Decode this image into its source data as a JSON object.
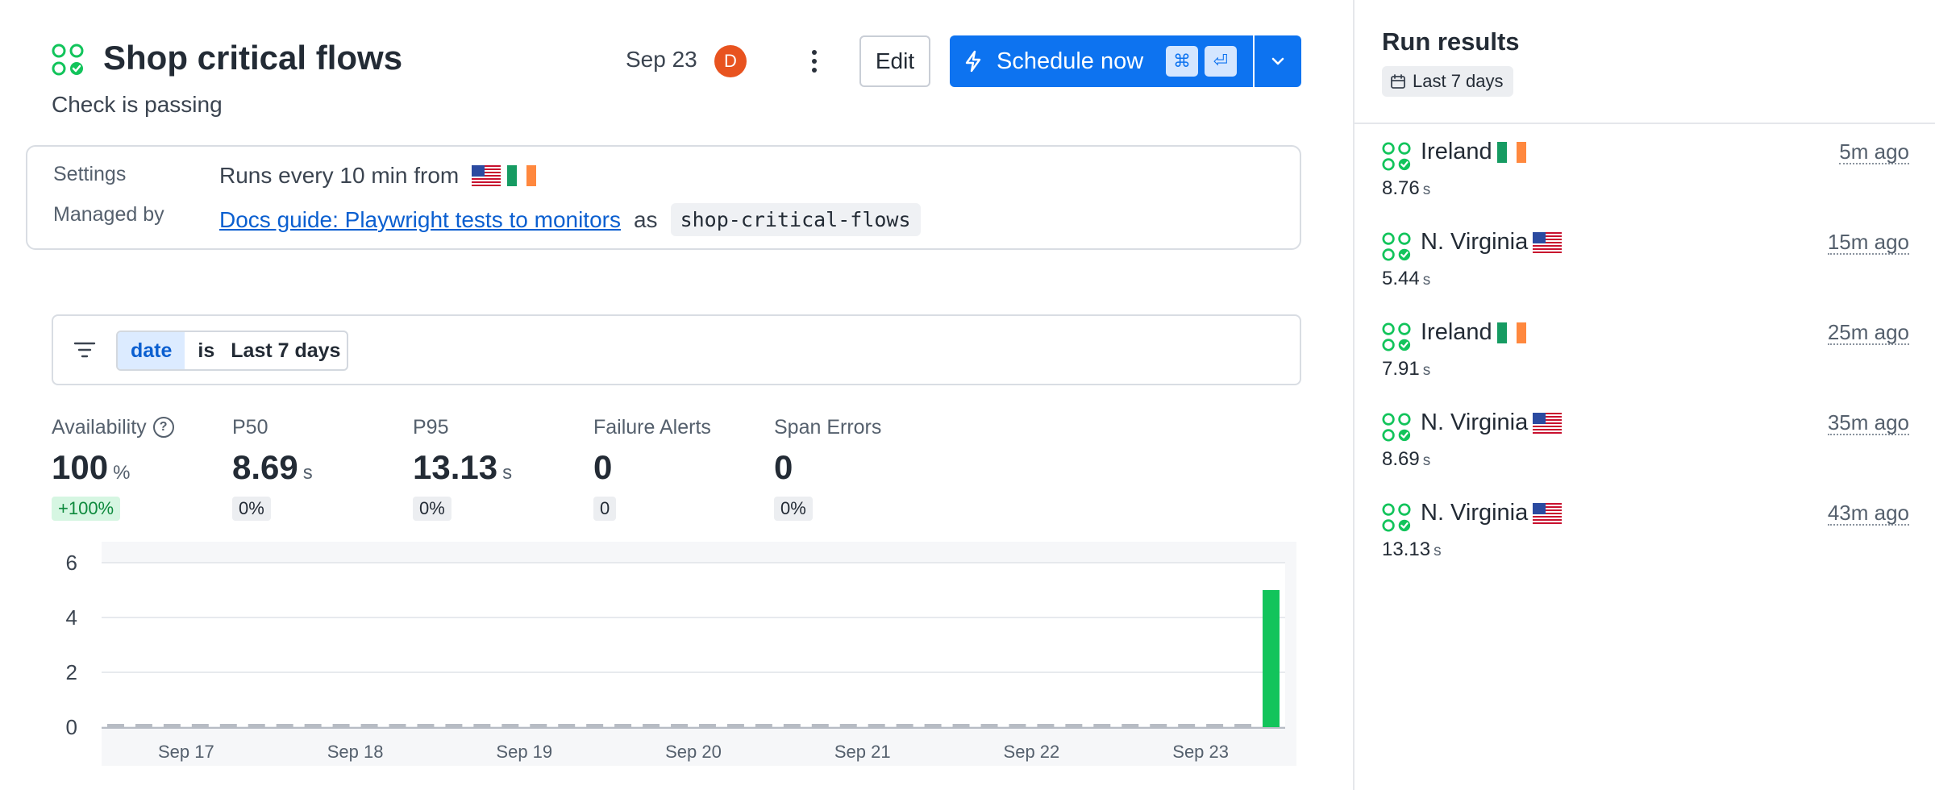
{
  "header": {
    "title": "Shop critical flows",
    "status_text": "Check is passing",
    "date": "Sep 23",
    "avatar_initial": "D",
    "edit_label": "Edit",
    "schedule_label": "Schedule now",
    "kbd_cmd": "⌘",
    "kbd_enter": "⏎"
  },
  "settings": {
    "settings_label": "Settings",
    "settings_value": "Runs every 10 min from",
    "managed_label": "Managed by",
    "managed_link": "Docs guide: Playwright tests to monitors",
    "managed_as": "as",
    "managed_code": "shop-critical-flows"
  },
  "filter": {
    "key": "date",
    "operator": "is",
    "value": "Last 7 days"
  },
  "metrics": [
    {
      "label": "Availability",
      "value": "100",
      "unit": "%",
      "badge": "+100%"
    },
    {
      "label": "P50",
      "value": "8.69",
      "unit": "s",
      "badge": "0%"
    },
    {
      "label": "P95",
      "value": "13.13",
      "unit": "s",
      "badge": "0%"
    },
    {
      "label": "Failure Alerts",
      "value": "0",
      "unit": "",
      "badge": "0"
    },
    {
      "label": "Span Errors",
      "value": "0",
      "unit": "",
      "badge": "0%"
    }
  ],
  "chart_data": {
    "type": "bar",
    "x_ticks": [
      "Sep 17",
      "Sep 18",
      "Sep 19",
      "Sep 20",
      "Sep 21",
      "Sep 22",
      "Sep 23"
    ],
    "y_ticks": [
      0,
      2,
      4,
      6
    ],
    "ylim": [
      0,
      6
    ],
    "bucket_count": 42,
    "values": [
      0,
      0,
      0,
      0,
      0,
      0,
      0,
      0,
      0,
      0,
      0,
      0,
      0,
      0,
      0,
      0,
      0,
      0,
      0,
      0,
      0,
      0,
      0,
      0,
      0,
      0,
      0,
      0,
      0,
      0,
      0,
      0,
      0,
      0,
      0,
      0,
      0,
      0,
      0,
      0,
      0,
      5
    ],
    "series_color": "#12c45b",
    "zero_color": "#b7bcc4",
    "grid": true,
    "xlabel": "",
    "ylabel": "",
    "title": ""
  },
  "sidebar": {
    "title": "Run results",
    "filter_label": "Last 7 days",
    "runs": [
      {
        "location": "Ireland",
        "flag": "ie",
        "time": "5m ago",
        "duration": "8.76",
        "unit": "s"
      },
      {
        "location": "N. Virginia",
        "flag": "us",
        "time": "15m ago",
        "duration": "5.44",
        "unit": "s"
      },
      {
        "location": "Ireland",
        "flag": "ie",
        "time": "25m ago",
        "duration": "7.91",
        "unit": "s"
      },
      {
        "location": "N. Virginia",
        "flag": "us",
        "time": "35m ago",
        "duration": "8.69",
        "unit": "s"
      },
      {
        "location": "N. Virginia",
        "flag": "us",
        "time": "43m ago",
        "duration": "13.13",
        "unit": "s"
      }
    ]
  },
  "colors": {
    "accent": "#0d73f0",
    "success": "#12c45b",
    "link": "#0b5fd0",
    "avatar": "#e8531f"
  }
}
